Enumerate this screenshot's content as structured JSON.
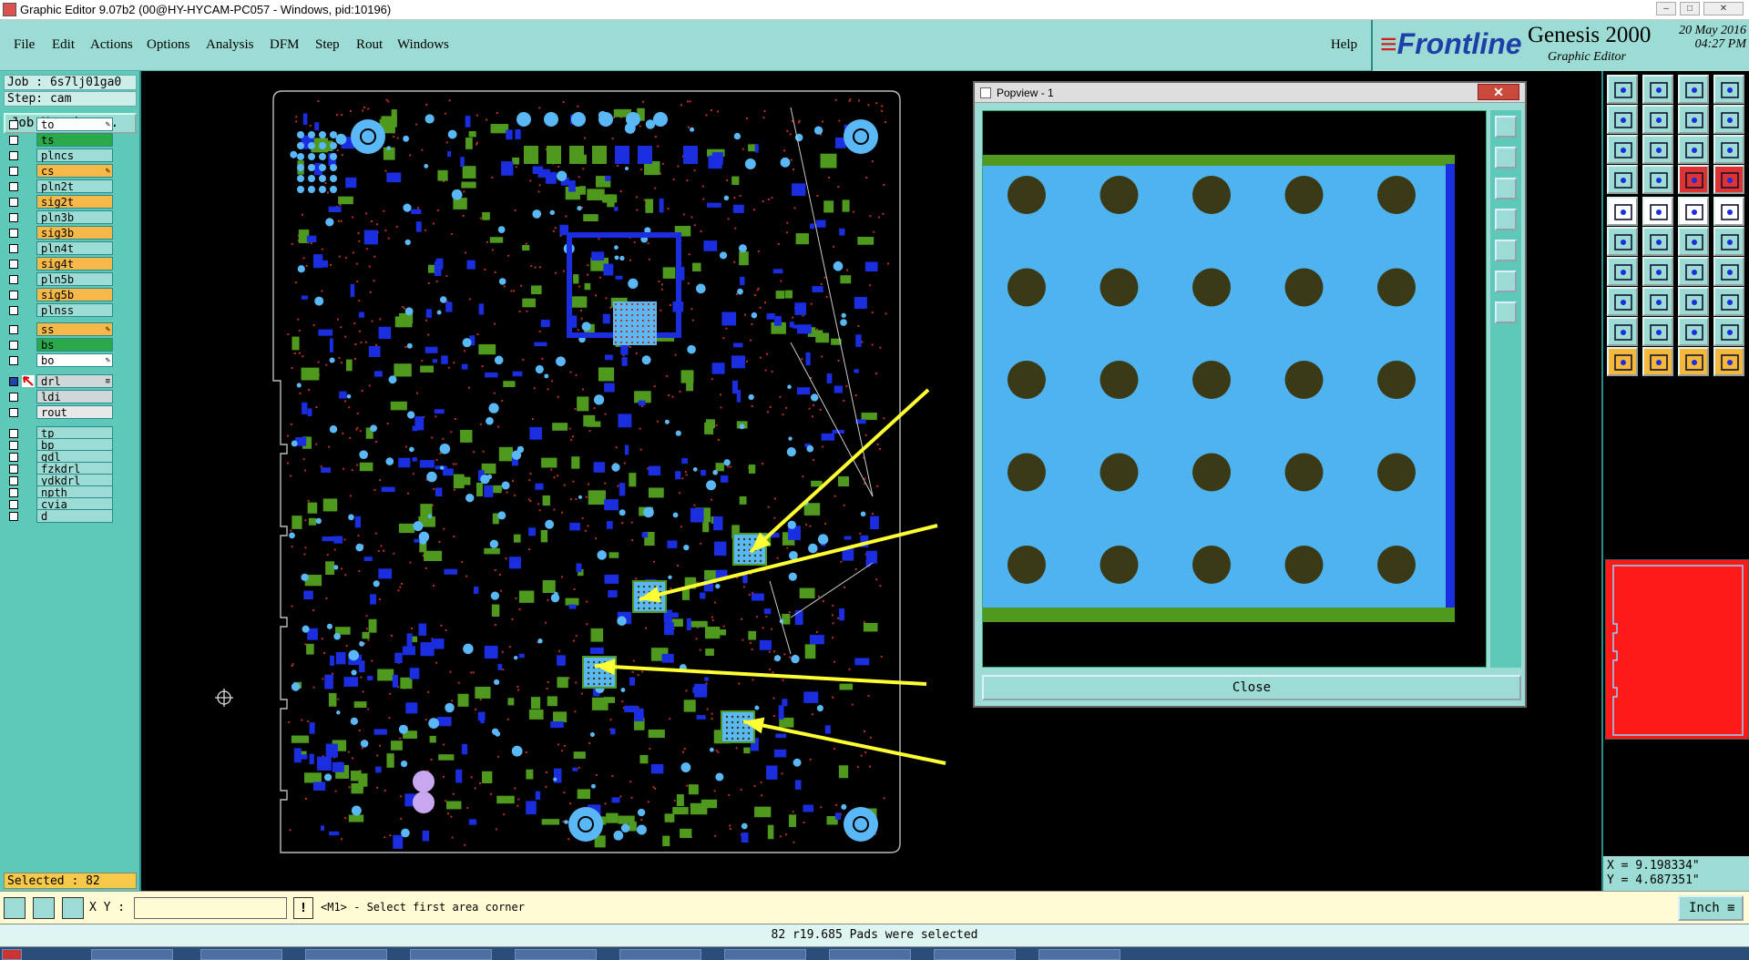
{
  "window": {
    "title": "Graphic Editor 9.07b2 (00@HY-HYCAM-PC057 - Windows, pid:10196)",
    "min_label": "–",
    "max_label": "□",
    "close_label": "✕"
  },
  "menu": {
    "items": [
      "File",
      "Edit",
      "Actions",
      "Options",
      "Analysis",
      "DFM",
      "Step",
      "Rout",
      "Windows"
    ],
    "help": "Help"
  },
  "brand": {
    "logo_text": "Frontline",
    "product": "Genesis 2000",
    "subtitle": "Graphic Editor",
    "date": "20 May 2016",
    "time": "04:27 PM"
  },
  "job": {
    "job_label": "Job : 6s7lj01ga0",
    "step_label": "Step: cam",
    "matrix_button": "Job Matrix ..."
  },
  "layers": [
    {
      "name": "to",
      "bg": "#ffffff",
      "flag": "✎"
    },
    {
      "name": "ts",
      "bg": "#2aa84a",
      "flag": ""
    },
    {
      "name": "plncs",
      "bg": "#9cdcd4",
      "flag": ""
    },
    {
      "name": "cs",
      "bg": "#f7b84a",
      "flag": "✎"
    },
    {
      "name": "pln2t",
      "bg": "#9cdcd4",
      "flag": ""
    },
    {
      "name": "sig2t",
      "bg": "#f7b84a",
      "flag": ""
    },
    {
      "name": "pln3b",
      "bg": "#9cdcd4",
      "flag": ""
    },
    {
      "name": "sig3b",
      "bg": "#f7b84a",
      "flag": ""
    },
    {
      "name": "pln4t",
      "bg": "#9cdcd4",
      "flag": ""
    },
    {
      "name": "sig4t",
      "bg": "#f7b84a",
      "flag": ""
    },
    {
      "name": "pln5b",
      "bg": "#9cdcd4",
      "flag": ""
    },
    {
      "name": "sig5b",
      "bg": "#f7b84a",
      "flag": ""
    },
    {
      "name": "plnss",
      "bg": "#9cdcd4",
      "flag": ""
    },
    {
      "name": "ss",
      "bg": "#f7b84a",
      "flag": "✎"
    },
    {
      "name": "bs",
      "bg": "#2aa84a",
      "flag": ""
    },
    {
      "name": "bo",
      "bg": "#ffffff",
      "flag": "✎"
    },
    {
      "name": "drl",
      "bg": "#cfd8d8",
      "flag": "≡"
    },
    {
      "name": "ldi",
      "bg": "#cfd8d8",
      "flag": ""
    },
    {
      "name": "rout",
      "bg": "#e8e8e8",
      "flag": ""
    },
    {
      "name": "tp",
      "bg": "#9cdcd4",
      "flag": ""
    },
    {
      "name": "bp",
      "bg": "#9cdcd4",
      "flag": ""
    },
    {
      "name": "gdl",
      "bg": "#9cdcd4",
      "flag": ""
    },
    {
      "name": "fzkdrl",
      "bg": "#9cdcd4",
      "flag": ""
    },
    {
      "name": "ydkdrl",
      "bg": "#9cdcd4",
      "flag": ""
    },
    {
      "name": "npth",
      "bg": "#9cdcd4",
      "flag": ""
    },
    {
      "name": "cvia",
      "bg": "#9cdcd4",
      "flag": ""
    },
    {
      "name": "d",
      "bg": "#9cdcd4",
      "flag": ""
    }
  ],
  "selected_count_label": "Selected : 82",
  "popview": {
    "title": "Popview - 1",
    "close_button": "Close",
    "close_x": "✕"
  },
  "coords": {
    "x": "X = 9.198334\"",
    "y": "Y = 4.687351\""
  },
  "bottom": {
    "xy_label": "X Y :",
    "xy_value": "",
    "warn": "!",
    "prompt": "<M1> - Select first area corner",
    "unit": "Inch"
  },
  "status": "82 r19.685 Pads were selected",
  "colors": {
    "panel": "#9cdcd4",
    "panel_dark": "#5ec9b9",
    "pad_light_blue": "#4fb3f0",
    "pad_blue": "#1a2ee0",
    "green": "#4f9a1e",
    "arrow": "#ffff33"
  }
}
